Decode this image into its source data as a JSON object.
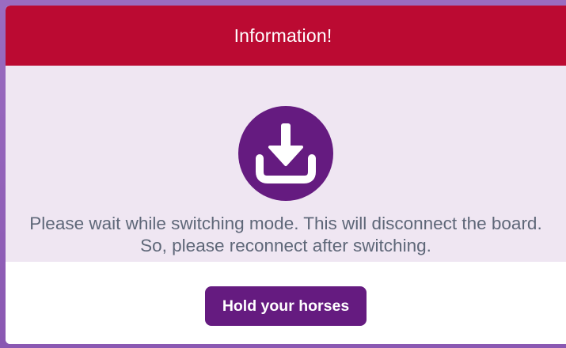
{
  "dialog": {
    "title": "Information!",
    "icon": "download-icon",
    "message_line1": "Please wait while switching mode. This will disconnect the board.",
    "message_line2": "So, please reconnect after switching.",
    "button_label": "Hold your horses"
  },
  "colors": {
    "header": "#bb0a32",
    "body_background": "#efe6f2",
    "accent": "#651b80",
    "message_text": "#5e6778",
    "backdrop": "#8b5bb0"
  }
}
